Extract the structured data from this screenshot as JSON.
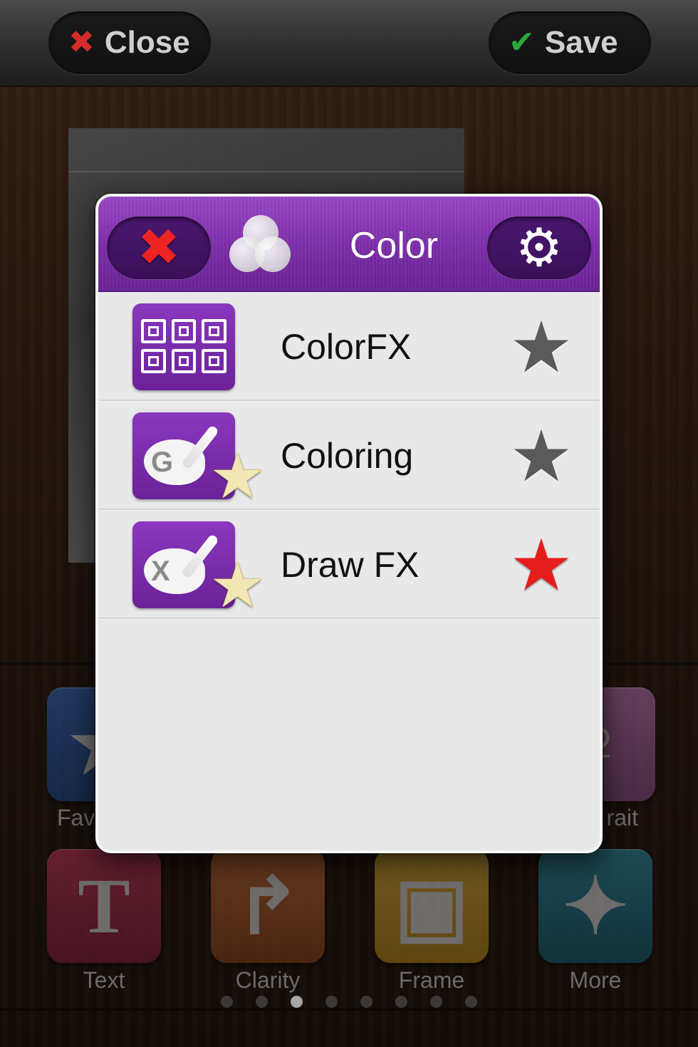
{
  "topbar": {
    "close_label": "Close",
    "save_label": "Save",
    "close_icon": "x-icon",
    "save_icon": "checkmark-icon"
  },
  "tools": [
    {
      "label": "Fav",
      "icon": "star-icon",
      "color": "#2f5fae"
    },
    {
      "label": "rait",
      "icon": "portrait-icon",
      "color": "#b06aa8"
    },
    {
      "label": "Text",
      "icon": "text-T-icon",
      "color": "#b23252"
    },
    {
      "label": "Clarity",
      "icon": "clarity-arrows-icon",
      "color": "#b85f30"
    },
    {
      "label": "Frame",
      "icon": "frame-icon",
      "color": "#d8a830"
    },
    {
      "label": "More",
      "icon": "puzzle-icon",
      "color": "#277e96"
    }
  ],
  "tool_glyphs": {
    "fav": "★",
    "portrait": "♀",
    "text": "T",
    "clarity": "↱",
    "frame": "▣",
    "more": "✦"
  },
  "pager": {
    "count": 8,
    "active_index": 2
  },
  "popup": {
    "title": "Color",
    "close_glyph": "✖",
    "settings_glyph": "⚙",
    "accent_color": "#7d2eaa",
    "items": [
      {
        "label": "ColorFX",
        "icon": "colorfx-grid-icon",
        "favorite": false
      },
      {
        "label": "Coloring",
        "icon": "coloring-palette-icon",
        "badge": "G",
        "favorite": false
      },
      {
        "label": "Draw FX",
        "icon": "drawfx-palette-icon",
        "badge": "X",
        "favorite": true
      }
    ],
    "star_glyph": "★"
  }
}
